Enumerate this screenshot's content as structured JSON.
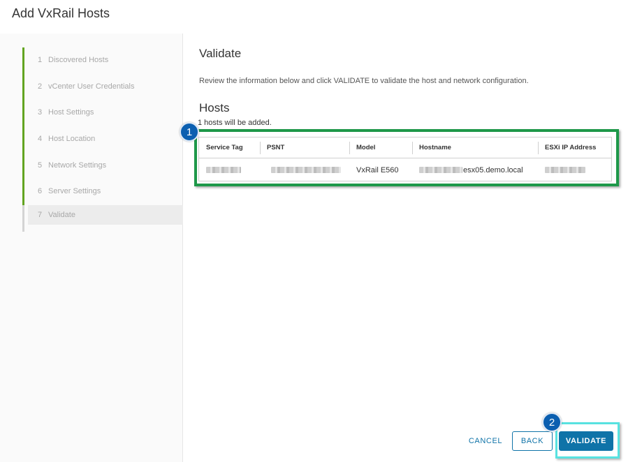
{
  "window": {
    "title": "Add VxRail Hosts"
  },
  "steps": [
    {
      "num": "1",
      "label": "Discovered Hosts"
    },
    {
      "num": "2",
      "label": "vCenter User Credentials"
    },
    {
      "num": "3",
      "label": "Host Settings"
    },
    {
      "num": "4",
      "label": "Host Location"
    },
    {
      "num": "5",
      "label": "Network Settings"
    },
    {
      "num": "6",
      "label": "Server Settings"
    },
    {
      "num": "7",
      "label": "Validate"
    }
  ],
  "page": {
    "heading": "Validate",
    "instructions": "Review the information below and click VALIDATE to validate the host and network configuration.",
    "hosts_heading": "Hosts",
    "hosts_count": "1 hosts will be added."
  },
  "table": {
    "columns": [
      "Service Tag",
      "PSNT",
      "Model",
      "Hostname",
      "ESXi IP Address"
    ],
    "rows": [
      {
        "service_tag": "",
        "psnt": "",
        "model": "VxRail E560",
        "hostname": "esx05.demo.local",
        "ip": ""
      }
    ]
  },
  "badges": {
    "one": "1",
    "two": "2"
  },
  "footer": {
    "cancel": "CANCEL",
    "back": "BACK",
    "validate": "VALIDATE"
  },
  "colors": {
    "accent": "#0f73a8",
    "step_done": "#62a420",
    "highlight_green": "#1e9849",
    "highlight_cyan": "#58e2e0",
    "badge": "#0b5fb0"
  }
}
